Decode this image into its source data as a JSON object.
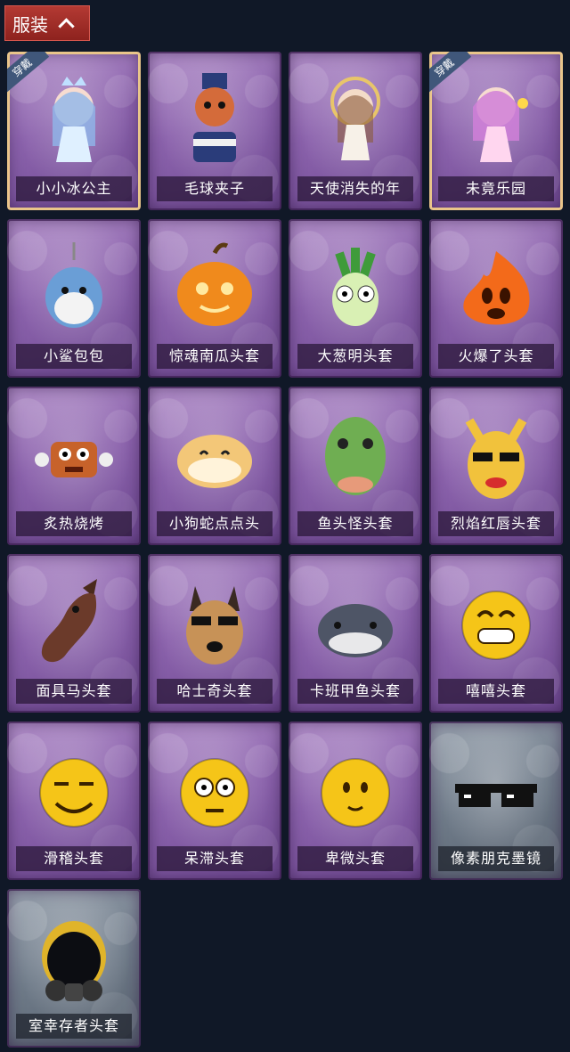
{
  "header": {
    "label": "服装"
  },
  "badge_text": "穿戴",
  "items": [
    {
      "name": "小小冰公主",
      "icon": "ice-princess-icon",
      "equipped": true,
      "color": "#8fb7ea"
    },
    {
      "name": "毛球夹子",
      "icon": "raccoon-drummer-icon",
      "equipped": false,
      "color": "#d46b3a"
    },
    {
      "name": "天使消失的年",
      "icon": "angel-doll-icon",
      "equipped": false,
      "color": "#e8d6c0"
    },
    {
      "name": "未竟乐园",
      "icon": "candy-girl-icon",
      "equipped": true,
      "color": "#d07fd8"
    },
    {
      "name": "小鲨包包",
      "icon": "shark-bag-icon",
      "equipped": false,
      "color": "#6a9ed6"
    },
    {
      "name": "惊魂南瓜头套",
      "icon": "pumpkin-head-icon",
      "equipped": false,
      "color": "#f08a1c"
    },
    {
      "name": "大葱明头套",
      "icon": "scallion-head-icon",
      "equipped": false,
      "color": "#8fd06b"
    },
    {
      "name": "火爆了头套",
      "icon": "fire-head-icon",
      "equipped": false,
      "color": "#f36a1a"
    },
    {
      "name": "炙热烧烤",
      "icon": "bbq-meat-icon",
      "equipped": false,
      "color": "#c7622a"
    },
    {
      "name": "小狗蛇点点头",
      "icon": "dog-snake-icon",
      "equipped": false,
      "color": "#f3c778"
    },
    {
      "name": "鱼头怪头套",
      "icon": "fish-head-icon",
      "equipped": false,
      "color": "#6fae52"
    },
    {
      "name": "烈焰红唇头套",
      "icon": "yellow-mask-icon",
      "equipped": false,
      "color": "#f1c23c"
    },
    {
      "name": "面具马头套",
      "icon": "horse-head-icon",
      "equipped": false,
      "color": "#6b3a2a"
    },
    {
      "name": "哈士奇头套",
      "icon": "husky-head-icon",
      "equipped": false,
      "color": "#c79257"
    },
    {
      "name": "卡班甲鱼头套",
      "icon": "fish-dome-icon",
      "equipped": false,
      "color": "#4e5566"
    },
    {
      "name": "嘻嘻头套",
      "icon": "grin-emoji-icon",
      "equipped": false,
      "color": "#f5c518"
    },
    {
      "name": "滑稽头套",
      "icon": "funny-emoji-icon",
      "equipped": false,
      "color": "#f5c518"
    },
    {
      "name": "呆滞头套",
      "icon": "dazed-emoji-icon",
      "equipped": false,
      "color": "#f5c518"
    },
    {
      "name": "卑微头套",
      "icon": "humble-emoji-icon",
      "equipped": false,
      "color": "#f5c518"
    },
    {
      "name": "像素朋克墨镜",
      "icon": "pixel-sunglasses-icon",
      "equipped": false,
      "color": "#111111",
      "grey": true
    },
    {
      "name": "室幸存者头套",
      "icon": "gas-mask-helmet-icon",
      "equipped": false,
      "color": "#2a2f3a",
      "grey": true
    }
  ]
}
